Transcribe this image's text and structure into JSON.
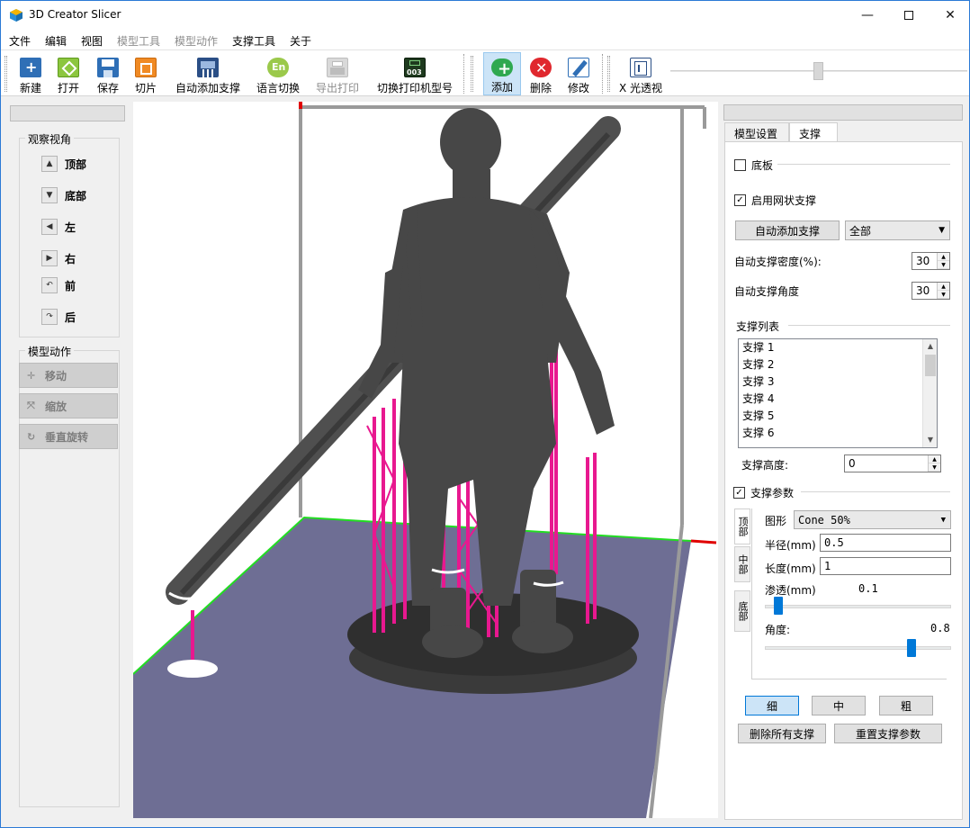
{
  "window": {
    "title": "3D Creator Slicer"
  },
  "menu": [
    "文件",
    "编辑",
    "视图",
    "模型工具",
    "模型动作",
    "支撑工具",
    "关于"
  ],
  "menu_disabled": [
    "模型工具",
    "模型动作"
  ],
  "toolbar": {
    "new": "新建",
    "open": "打开",
    "save": "保存",
    "slice": "切片",
    "auto_support": "自动添加支撑",
    "language": "语言切换",
    "export_print": "导出打印",
    "switch_printer": "切换打印机型号",
    "printer_badge": "003",
    "add": "添加",
    "delete": "删除",
    "modify": "修改",
    "xray": "X 光透视"
  },
  "left": {
    "view_group": "观察视角",
    "views": [
      "顶部",
      "底部",
      "左",
      "右",
      "前",
      "后"
    ],
    "action_group": "模型动作",
    "actions": [
      "移动",
      "缩放",
      "垂直旋转"
    ]
  },
  "right": {
    "tabs": [
      "模型设置",
      "支撑"
    ],
    "base_label": "底板",
    "base_checked": false,
    "mesh_support_label": "启用网状支撑",
    "mesh_support_checked": true,
    "auto_add_button": "自动添加支撑",
    "scope_value": "全部",
    "density_label": "自动支撑密度(%):",
    "density_value": "30",
    "angle_label": "自动支撑角度",
    "angle_value": "30",
    "list_title": "支撑列表",
    "list_items": [
      "支撑 1",
      "支撑 2",
      "支撑 3",
      "支撑 4",
      "支撑 5",
      "支撑 6"
    ],
    "height_label": "支撑高度:",
    "height_value": "0",
    "param_label": "支撑参数",
    "param_checked": true,
    "vtabs": [
      "顶部",
      "中部",
      "底部"
    ],
    "shape_label": "图形",
    "shape_value": "Cone 50%",
    "radius_label": "半径(mm)",
    "radius_value": "0.5",
    "length_label": "长度(mm)",
    "length_value": "1",
    "penetration_label": "渗透(mm)",
    "penetration_value": "0.1",
    "penetration_level": 0.05,
    "angle2_label": "角度:",
    "angle2_value": "0.8",
    "angle2_level": 0.8,
    "sizes": [
      "细",
      "中",
      "粗"
    ],
    "delete_all": "删除所有支撑",
    "reset_params": "重置支撑参数"
  },
  "colors": {
    "support": "#e8188f",
    "model": "#4a4a4a",
    "bed": "#6e6e94",
    "bed_edge": "#22dd22",
    "accent": "#0078d7"
  }
}
